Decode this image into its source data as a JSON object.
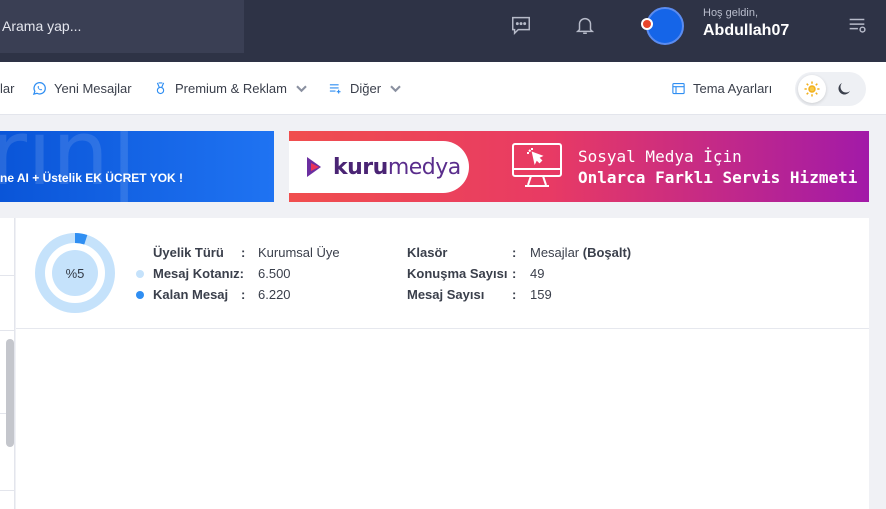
{
  "header": {
    "search_placeholder": "Arama yap...",
    "greeting": "Hoş geldin,",
    "username": "Abdullah07",
    "icons": [
      "chat-icon",
      "bell-icon",
      "settings-list-icon"
    ]
  },
  "nav": {
    "partial_item": "lar",
    "items": [
      {
        "label": "Yeni Mesajlar",
        "icon": "whatsapp-icon"
      },
      {
        "label": "Premium & Reklam",
        "icon": "award-icon",
        "dropdown": true
      },
      {
        "label": "Diğer",
        "icon": "list-plus-icon",
        "dropdown": true
      }
    ],
    "theme_settings": "Tema Ayarları"
  },
  "banners": {
    "left_slogan": "ne AI + Üstelik EK ÜCRET YOK !",
    "right_logo_bold": "kuru",
    "right_logo_regular": "medya",
    "right_line1": "Sosyal Medya İçin",
    "right_line2": "Onlarca Farklı Servis Hizmeti"
  },
  "stats": {
    "percent_label": "%5",
    "percent_value": 5,
    "fields_left": [
      {
        "label": "Üyelik Türü",
        "value": "Kurumsal Üye"
      },
      {
        "label": "Mesaj Kotanız:",
        "value": "6.500"
      },
      {
        "label": "Kalan Mesaj",
        "value": "6.220"
      }
    ],
    "fields_right": [
      {
        "label": "Klasör",
        "value": "Mesajlar",
        "action": "(Boşalt)"
      },
      {
        "label": "Konuşma Sayısı",
        "value": "49"
      },
      {
        "label": "Mesaj Sayısı",
        "value": "159"
      }
    ],
    "colon": ":"
  },
  "colors": {
    "topbar": "#2e3346",
    "accent_blue": "#2f8ef2",
    "light_blue": "#c5e2fb",
    "banner_red": "#f04e4e",
    "banner_purple": "#a21aa8"
  }
}
